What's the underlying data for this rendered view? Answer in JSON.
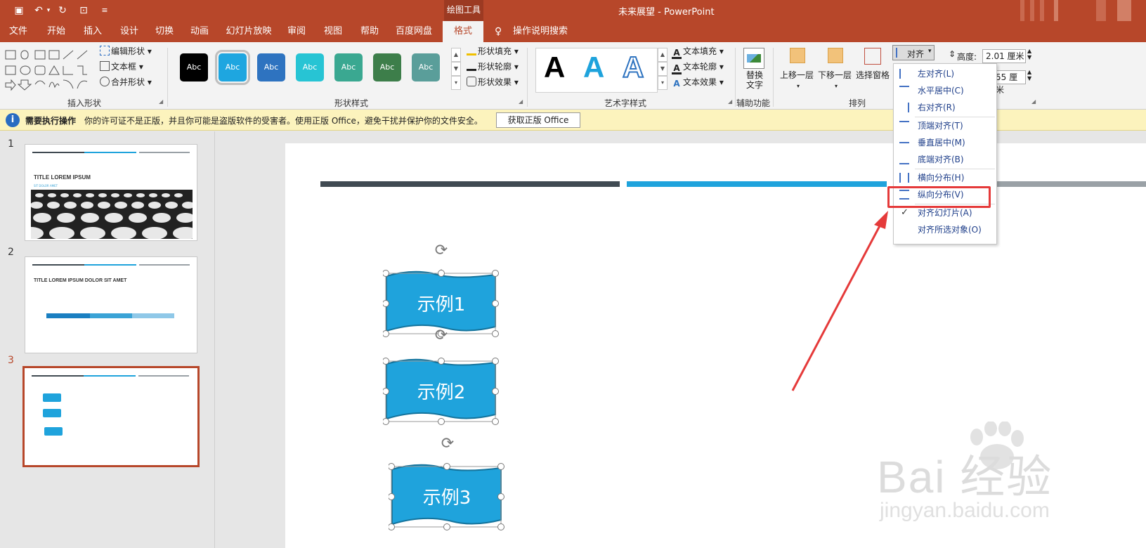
{
  "title_bar": {
    "drawing_tools": "绘图工具",
    "doc_title": "未来展望  -  PowerPoint"
  },
  "tabs": [
    "文件",
    "开始",
    "插入",
    "设计",
    "切换",
    "动画",
    "幻灯片放映",
    "审阅",
    "视图",
    "帮助",
    "百度网盘",
    "格式"
  ],
  "search_tip": "操作说明搜索",
  "ribbon": {
    "insert_shapes": {
      "label": "插入形状",
      "edit_shape": "编辑形状",
      "text_box": "文本框",
      "merge_shapes": "合并形状"
    },
    "shape_styles": {
      "label": "形状样式",
      "swatches": [
        {
          "text": "Abc",
          "color": "#000000"
        },
        {
          "text": "Abc",
          "color": "#1ea6e0"
        },
        {
          "text": "Abc",
          "color": "#2e73c0"
        },
        {
          "text": "Abc",
          "color": "#27c4d4"
        },
        {
          "text": "Abc",
          "color": "#3aa891"
        },
        {
          "text": "Abc",
          "color": "#3d7e4a"
        },
        {
          "text": "Abc",
          "color": "#5a9e9a"
        }
      ],
      "fill": "形状填充",
      "outline": "形状轮廓",
      "effects": "形状效果"
    },
    "wordart": {
      "label": "艺术字样式",
      "letters": [
        "A",
        "A",
        "A"
      ],
      "text_fill": "文本填充",
      "text_outline": "文本轮廓",
      "text_effects": "文本效果"
    },
    "accessibility": {
      "label": "辅助功能",
      "alt_text": "替换文字"
    },
    "arrange": {
      "label": "排列",
      "bring_forward": "上移一层",
      "send_backward": "下移一层",
      "selection_pane": "选择窗格",
      "align": "对齐"
    },
    "size": {
      "height_label": "高度:",
      "height_value": "2.01 厘米",
      "width_value": "55 厘米"
    }
  },
  "infobar": {
    "title": "需要执行操作",
    "message": "你的许可证不是正版，并且你可能是盗版软件的受害者。使用正版 Office，避免干扰并保护你的文件安全。",
    "button": "获取正版 Office"
  },
  "slides": [
    {
      "num": "1",
      "title": "TITLE LOREM IPSUM",
      "sub": "SIT DOLOR AMET"
    },
    {
      "num": "2",
      "title": "TITLE LOREM IPSUM DOLOR SIT AMET"
    },
    {
      "num": "3"
    }
  ],
  "slide_shapes": [
    "示例1",
    "示例2",
    "示例3"
  ],
  "align_menu": [
    {
      "label": "左对齐(L)"
    },
    {
      "label": "水平居中(C)"
    },
    {
      "label": "右对齐(R)"
    },
    {
      "label": "顶端对齐(T)"
    },
    {
      "label": "垂直居中(M)"
    },
    {
      "label": "底端对齐(B)"
    },
    {
      "label": "横向分布(H)"
    },
    {
      "label": "纵向分布(V)"
    },
    {
      "label": "对齐幻灯片(A)"
    },
    {
      "label": "对齐所选对象(O)"
    }
  ],
  "watermark": {
    "logo": "Bai 经验",
    "url": "jingyan.baidu.com"
  },
  "colors": {
    "accent": "#b7472a",
    "shape_blue": "#1fa3dc",
    "bar_dark": "#404a52",
    "bar_blue": "#1fa3dc",
    "bar_gray": "#9aa1a6",
    "highlight": "#e53a3a"
  }
}
